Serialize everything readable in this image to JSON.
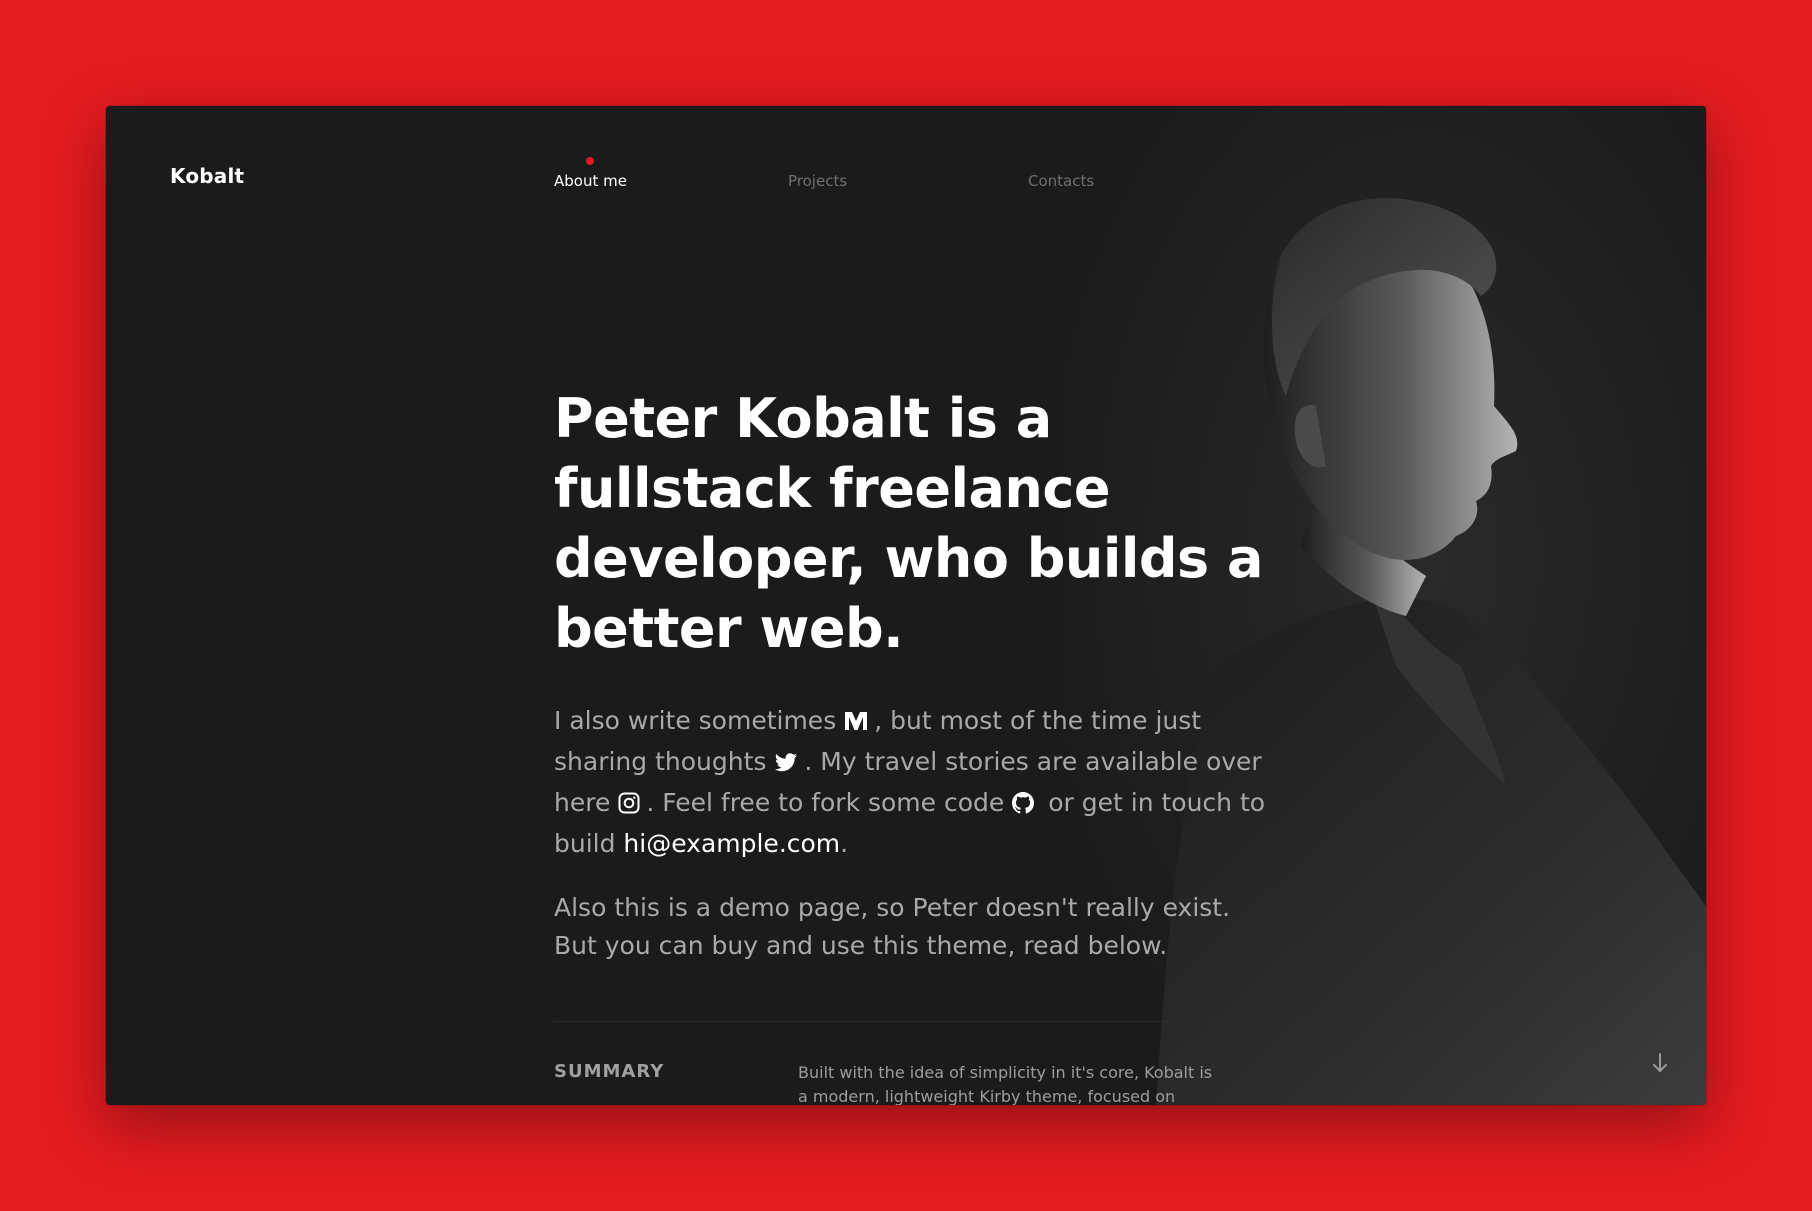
{
  "brand": {
    "logo": "Kobalt"
  },
  "nav": {
    "items": [
      {
        "label": "About me",
        "active": true
      },
      {
        "label": "Projects",
        "active": false
      },
      {
        "label": "Contacts",
        "active": false
      }
    ]
  },
  "hero": {
    "headline": "Peter Kobalt is a fullstack freelance developer, who builds a better web.",
    "intro": {
      "part1": "I also write sometimes",
      "part2": ", but most of the time just sharing thoughts",
      "part3": ". My travel stories are available over here",
      "part4": ". Feel free to fork some code",
      "part5": " or get in touch to build ",
      "email": "hi@example.com",
      "part6": "."
    },
    "demo_note": "Also this is a demo page, so Peter doesn't really exist. But you can buy and use this theme, read below."
  },
  "summary": {
    "label": "SUMMARY",
    "text": "Built with the idea of simplicity in it's core, Kobalt is a modern, lightweight Kirby theme, focused on"
  },
  "icons": {
    "medium": "medium-icon",
    "twitter": "twitter-icon",
    "instagram": "instagram-icon",
    "github": "github-icon",
    "scroll": "arrow-down-icon"
  },
  "colors": {
    "background": "#e41b20",
    "frame": "#1b1b1c",
    "accent": "#e41b20",
    "text_primary": "#ffffff",
    "text_muted": "#a9a9a9"
  }
}
